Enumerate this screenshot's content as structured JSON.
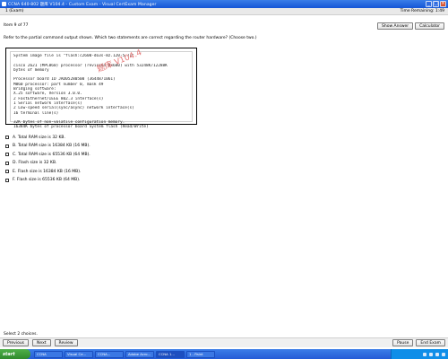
{
  "window": {
    "title": "CCNA 640-802 题库 V104.4 - Custom Exam - Visual CertExam Manager"
  },
  "menubar": {
    "item": "1 (Exam)",
    "time_remaining": "Time Remaining: 1:49"
  },
  "header": {
    "question_number": "Item 9 of 77",
    "show_answer": "Show Answer",
    "calculator": "Calculator"
  },
  "question": {
    "text": "Refer to the partial command output shown. Which two statements are correct regarding the router hardware? (Choose two.)"
  },
  "exhibit": {
    "lines": [
      "System image file is \"flash:c2600-do3s-mz.120-5.T1\"",
      "",
      "cisco 2621 (MPC860) processor (revision 0x600) with 53248K/12288K",
      "bytes of memory",
      "",
      "Processor board ID JAD05280500 (3644871061)",
      "M860 processor: part number 0, mask 49",
      "Bridging software:",
      "X.25 software, Version 3.0.0.",
      "2 FastEthernet/IEEE 802.3 interface(s)",
      "1 Serial network interface(s)",
      "2 Low-speed serial(sync/async) network interface(s)",
      "16 terminal line(s)",
      "",
      "32K bytes of non-volatile configuration memory.",
      "16384K bytes of processor board System flash (Read/Write)"
    ],
    "watermark": "题库 V104.4"
  },
  "options": [
    {
      "label": "A.  Total RAM size is 32 KB."
    },
    {
      "label": "B.  Total RAM size is 16384 KB (16 MB)."
    },
    {
      "label": "C.  Total RAM size is 65536 KB (64 MB)."
    },
    {
      "label": "D.  Flash size is 32 KB."
    },
    {
      "label": "E.  Flash size is 16384 KB (16 MB)."
    },
    {
      "label": "F.  Flash size is 65536 KB (64 MB)."
    }
  ],
  "status": {
    "text": "Select 2 choices."
  },
  "footer": {
    "previous": "Previous",
    "next": "Next",
    "review": "Review",
    "pause": "Pause",
    "end_exam": "End Exam"
  },
  "taskbar": {
    "start": "start",
    "tasks": [
      "CCNA",
      "Visual Ce...",
      "CCNA...",
      "Adobe Acro...",
      "CCNA 1...",
      "1 - Paint"
    ]
  }
}
